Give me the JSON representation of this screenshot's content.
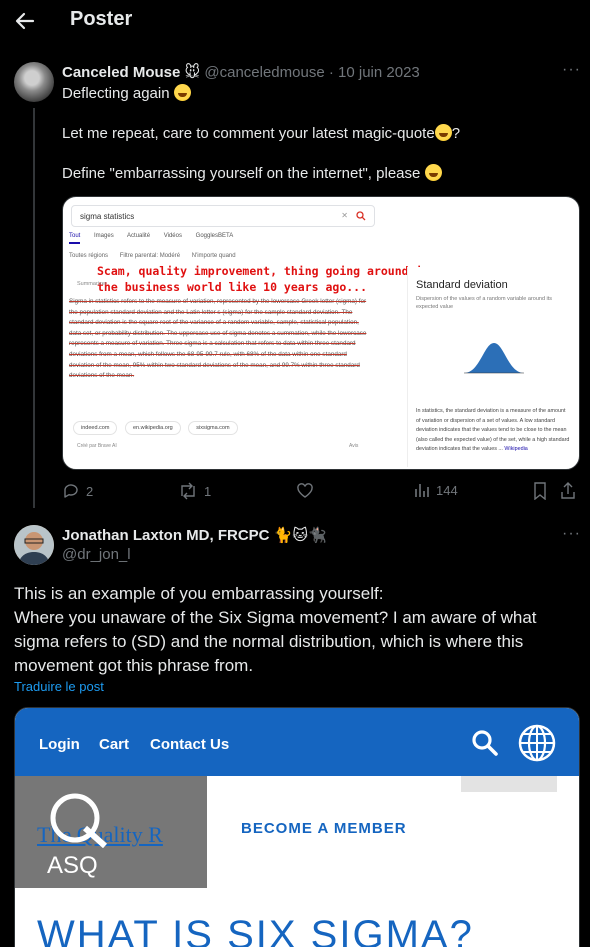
{
  "header": {
    "title": "Poster"
  },
  "tweet1": {
    "author_name": "Canceled Mouse",
    "author_emoji": "🐭",
    "handle": "@canceledmouse",
    "separator": "·",
    "date": "10 juin 2023",
    "more": "···",
    "lines": [
      "Deflecting again",
      "Let me repeat, care to comment your latest magic-quote",
      "?",
      "Define \"embarrassing yourself on the internet\", please"
    ],
    "embed": {
      "search_query": "sigma statistics",
      "tabs": [
        "Tout",
        "Images",
        "Actualité",
        "Vidéos",
        "GogglesBETA"
      ],
      "filters": [
        "Toutes régions",
        "Filtre parental: Modéré",
        "N'importe quand"
      ],
      "annotation": "Scam, quality improvement, thing going around in the business world like 10 years ago...",
      "summary_label": "Summarizer",
      "body": "Sigma in statistics refers to the measure of variation, represented by the lowercase Greek letter (sigma) for the population standard deviation and the Latin letter s (sigma) for the sample standard deviation. The standard deviation is the square root of the variance of a random variable, sample, statistical population, data set, or probability distribution. The uppercase use of sigma denotes a summation, while the lowercase represents a measure of variation. Three sigma is a calculation that refers to data within three standard deviations from a mean, which follows the 68-95-99.7 rule, with 68% of the data within one standard deviation of the mean, 95% within two standard deviations of the mean, and 99.7% within three standard deviations of the mean.",
      "sources": [
        "indeed.com",
        "en.wikipedia.org",
        "sixsigma.com"
      ],
      "footnote": "Créé par Brave AI",
      "avis": "Avis",
      "panel_title": "Standard deviation",
      "panel_sub": "Dispersion of the values of a random variable around its expected value",
      "panel_desc": "In statistics, the standard deviation is a measure of the amount of variation or dispersion of a set of values. A low standard deviation indicates that the values tend to be close to the mean (also called the expected value) of the set, while a high standard deviation indicates that the values ...",
      "panel_link": "Wikipedia"
    },
    "stats": {
      "replies": "2",
      "reposts": "1",
      "likes": "",
      "views": "144"
    }
  },
  "tweet2": {
    "author_name": "Jonathan Laxton MD, FRCPC",
    "author_emojis": "🐈🐱🐈‍⬛",
    "handle": "@dr_jon_l",
    "more": "···",
    "text_lines": [
      "This is an example of you embarrassing yourself:",
      "Where you unaware of the Six Sigma movement? I am aware of what sigma refers to (SD) and the normal distribution, which is where this movement got this phrase from."
    ],
    "translate": "Traduire le post",
    "embed": {
      "nav": [
        "Login",
        "Cart",
        "Contact Us"
      ],
      "logo_text": "ASQ",
      "logo_behind": "The Quality R",
      "member": "BECOME A MEMBER",
      "headline": "WHAT IS SIX SIGMA?"
    }
  },
  "colors": {
    "bg": "#000000",
    "text": "#e7e9ea",
    "muted": "#71767b",
    "link": "#1d9bf0",
    "asq_blue": "#1565c0",
    "annotation_red": "#e01010"
  }
}
